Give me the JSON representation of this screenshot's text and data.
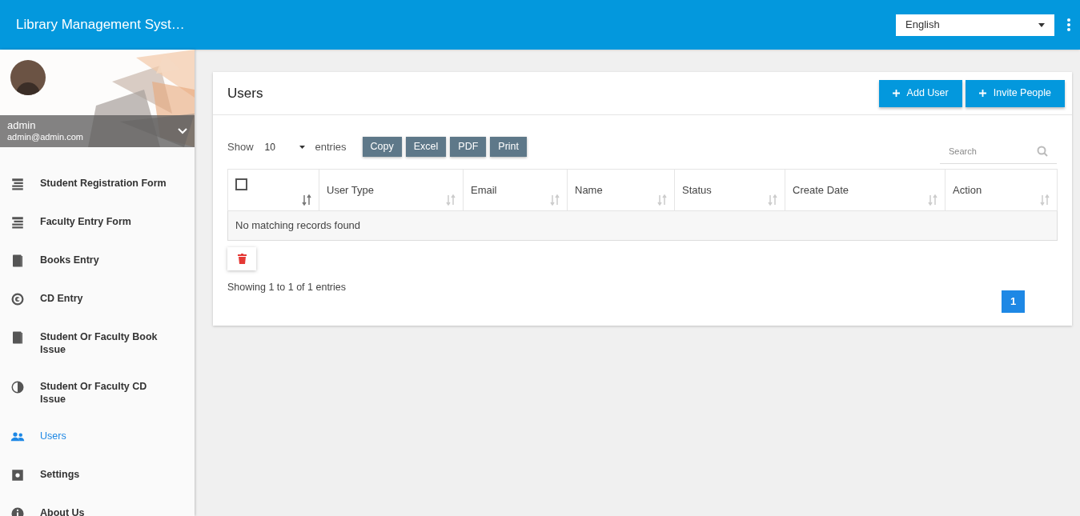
{
  "app_bar": {
    "title": "Library Management Syst…",
    "language": "English"
  },
  "profile": {
    "name": "admin",
    "email": "admin@admin.com"
  },
  "sidebar": {
    "items": [
      {
        "kind": "form",
        "label": "Student Registration Form",
        "selected": false
      },
      {
        "kind": "form",
        "label": "Faculty Entry Form",
        "selected": false
      },
      {
        "kind": "book",
        "label": "Books Entry",
        "selected": false
      },
      {
        "kind": "copyright",
        "label": "CD Entry",
        "selected": false
      },
      {
        "kind": "book",
        "label": "Student Or Faculty Book Issue",
        "selected": false
      },
      {
        "kind": "halfcircle",
        "label": "Student Or Faculty CD Issue",
        "selected": false
      },
      {
        "kind": "people",
        "label": "Users",
        "selected": true
      },
      {
        "kind": "gear",
        "label": "Settings",
        "selected": false
      },
      {
        "kind": "info",
        "label": "About Us",
        "selected": false
      }
    ]
  },
  "card": {
    "title": "Users",
    "buttons": [
      "Add User",
      "Invite People"
    ],
    "show_label": "Show",
    "page_size": "10",
    "entries_label": "entries",
    "export_buttons": [
      "Copy",
      "Excel",
      "PDF",
      "Print"
    ],
    "search": {
      "placeholder": "Search"
    },
    "table": {
      "select_all_checked": false,
      "columns": [
        "User Type",
        "Email",
        "Name",
        "Status",
        "Create Date",
        "Action"
      ],
      "empty_message": "No matching records found"
    },
    "info": "Showing 1 to 1 of 1 entries",
    "pages": [
      {
        "label": "1",
        "selected": true
      }
    ]
  }
}
